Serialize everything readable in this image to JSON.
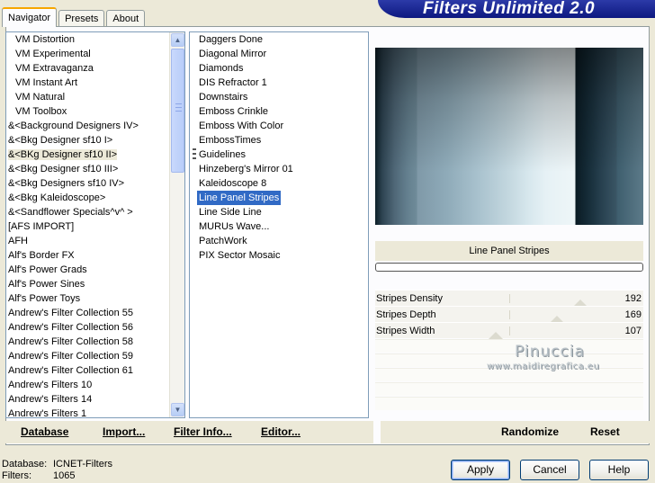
{
  "tabs": [
    {
      "label": "Navigator",
      "active": true
    },
    {
      "label": "Presets",
      "active": false
    },
    {
      "label": "About",
      "active": false
    }
  ],
  "banner": {
    "title": "Filters Unlimited 2.0",
    "color": "#0d1880"
  },
  "categories": {
    "items": [
      {
        "label": "VM Distortion",
        "style": "vm"
      },
      {
        "label": "VM Experimental",
        "style": "vm"
      },
      {
        "label": "VM Extravaganza",
        "style": "vm"
      },
      {
        "label": "VM Instant Art",
        "style": "vm"
      },
      {
        "label": "VM Natural",
        "style": "vm"
      },
      {
        "label": "VM Toolbox",
        "style": "vm"
      },
      {
        "label": "&<Background Designers IV>",
        "style": ""
      },
      {
        "label": "&<Bkg Designer sf10 I>",
        "style": ""
      },
      {
        "label": "&<BKg Designer sf10 II>",
        "style": "selected"
      },
      {
        "label": "&<Bkg Designer sf10 III>",
        "style": ""
      },
      {
        "label": "&<Bkg Designers sf10 IV>",
        "style": ""
      },
      {
        "label": "&<Bkg Kaleidoscope>",
        "style": ""
      },
      {
        "label": "&<Sandflower Specials^v^ >",
        "style": ""
      },
      {
        "label": "[AFS IMPORT]",
        "style": ""
      },
      {
        "label": "AFH",
        "style": ""
      },
      {
        "label": "Alf's Border FX",
        "style": ""
      },
      {
        "label": "Alf's Power Grads",
        "style": ""
      },
      {
        "label": "Alf's Power Sines",
        "style": ""
      },
      {
        "label": "Alf's Power Toys",
        "style": ""
      },
      {
        "label": "Andrew's Filter Collection 55",
        "style": ""
      },
      {
        "label": "Andrew's Filter Collection 56",
        "style": ""
      },
      {
        "label": "Andrew's Filter Collection 58",
        "style": ""
      },
      {
        "label": "Andrew's Filter Collection 59",
        "style": ""
      },
      {
        "label": "Andrew's Filter Collection 61",
        "style": ""
      },
      {
        "label": "Andrew's Filters 10",
        "style": ""
      },
      {
        "label": "Andrew's Filters 14",
        "style": ""
      },
      {
        "label": "Andrew's Filters 1",
        "style": ""
      }
    ],
    "scroll_up_icon": "arrow-up-icon",
    "scroll_down_icon": "arrow-down-icon"
  },
  "filters": {
    "items": [
      {
        "label": "Daggers Done",
        "selected": false
      },
      {
        "label": "Diagonal Mirror",
        "selected": false
      },
      {
        "label": "Diamonds",
        "selected": false
      },
      {
        "label": "DIS Refractor 1",
        "selected": false
      },
      {
        "label": "Downstairs",
        "selected": false
      },
      {
        "label": "Emboss Crinkle",
        "selected": false
      },
      {
        "label": "Emboss With Color",
        "selected": false
      },
      {
        "label": "EmbossTimes",
        "selected": false
      },
      {
        "label": "Guidelines",
        "selected": false
      },
      {
        "label": "Hinzeberg's Mirror 01",
        "selected": false
      },
      {
        "label": "Kaleidoscope 8",
        "selected": false
      },
      {
        "label": "Line Panel Stripes",
        "selected": true
      },
      {
        "label": "Line Side Line",
        "selected": false
      },
      {
        "label": "MURUs Wave...",
        "selected": false
      },
      {
        "label": "PatchWork",
        "selected": false
      },
      {
        "label": "PIX Sector Mosaic",
        "selected": false
      }
    ],
    "selection_color": "#316ac5"
  },
  "preview": {
    "filter_name": "Line Panel Stripes",
    "params": [
      {
        "label": "Stripes Density",
        "value": "192",
        "level": 0.75
      },
      {
        "label": "Stripes Depth",
        "value": "169",
        "level": 0.66
      },
      {
        "label": "Stripes Width",
        "value": "107",
        "level": 0.42
      }
    ],
    "watermark_name": "Pinuccia",
    "watermark_url": "www.maidiregrafica.eu"
  },
  "bottom_bar": {
    "database": "Database",
    "import": "Import...",
    "filter_info": "Filter Info...",
    "editor": "Editor...",
    "randomize": "Randomize",
    "reset": "Reset"
  },
  "status": {
    "database_label": "Database:",
    "database_value": "ICNET-Filters",
    "filters_label": "Filters:",
    "filters_value": "1065"
  },
  "dialog_buttons": {
    "apply": "Apply",
    "cancel": "Cancel",
    "help": "Help"
  }
}
